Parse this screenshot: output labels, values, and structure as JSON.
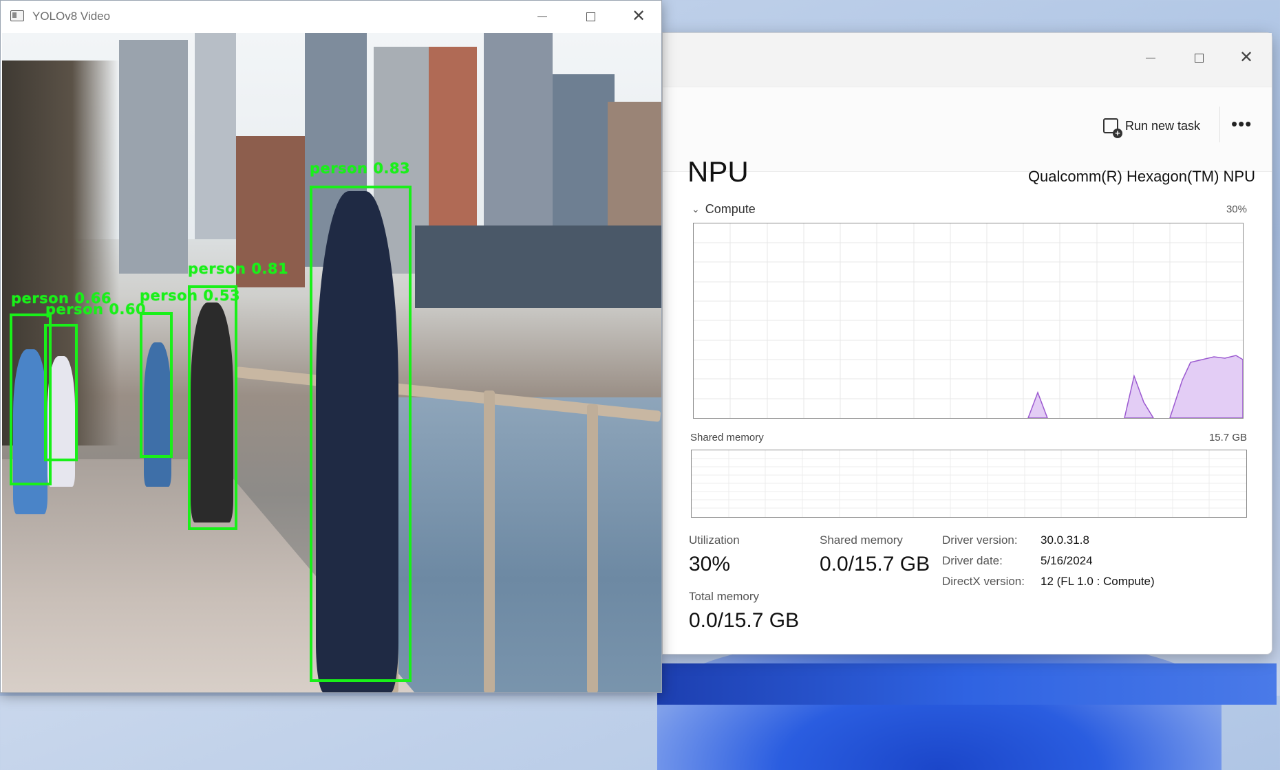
{
  "yolo_window": {
    "title": "YOLOv8 Video",
    "detections": [
      {
        "label": "person 0.83"
      },
      {
        "label": "person 0.81"
      },
      {
        "label": "person 0.53"
      },
      {
        "label": "person 0.66"
      },
      {
        "label": "person 0.60"
      }
    ],
    "box_color": "#19f019"
  },
  "task_manager": {
    "run_new_task_label": "Run new task",
    "more_label": "•••",
    "page_title": "NPU",
    "device_name": "Qualcomm(R) Hexagon(TM) NPU",
    "compute": {
      "label": "Compute",
      "max_label": "30%",
      "graph_color": "#9b59d0",
      "graph_fill": "#e3cdf5"
    },
    "shared_memory_graph": {
      "label": "Shared memory",
      "max_label": "15.7 GB"
    },
    "stats": {
      "utilization_label": "Utilization",
      "utilization_value": "30%",
      "shared_memory_label": "Shared memory",
      "shared_memory_value": "0.0/15.7 GB",
      "total_memory_label": "Total memory",
      "total_memory_value": "0.0/15.7 GB"
    },
    "details": [
      {
        "key": "Driver version:",
        "value": "30.0.31.8"
      },
      {
        "key": "Driver date:",
        "value": "5/16/2024"
      },
      {
        "key": "DirectX version:",
        "value": "12 (FL 1.0 : Compute)"
      }
    ]
  }
}
